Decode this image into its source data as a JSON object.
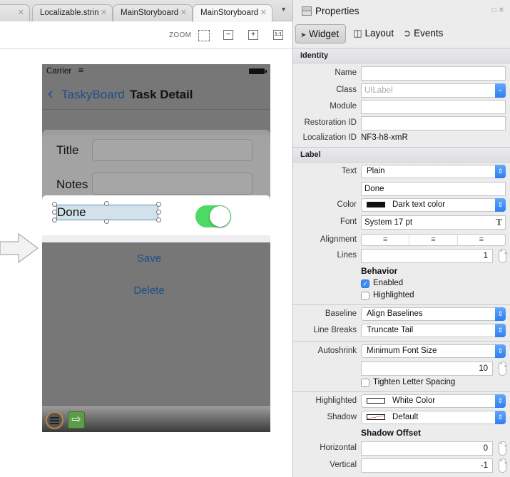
{
  "editor": {
    "tabs": [
      {
        "label": "",
        "active": false
      },
      {
        "label": "Localizable.strin",
        "active": false
      },
      {
        "label": "MainStoryboard",
        "active": false
      },
      {
        "label": "MainStoryboard",
        "active": true
      }
    ],
    "tab_close_glyph": "✕",
    "tab_dropdown_glyph": "▼",
    "zoom": {
      "label": "ZOOM",
      "buttons": [
        {
          "name": "zoom-fit",
          "glyph": ""
        },
        {
          "name": "zoom-out",
          "glyph": "−"
        },
        {
          "name": "zoom-in",
          "glyph": "+"
        },
        {
          "name": "zoom-actual",
          "glyph": "1:1"
        }
      ]
    }
  },
  "phone": {
    "carrier": "Carrier",
    "wifi_glyph": "≋",
    "back_label": "TaskyBoard",
    "back_glyph": "‹",
    "nav_title": "Task Detail",
    "title_label": "Title",
    "title_value": "",
    "notes_label": "Notes",
    "notes_value": "",
    "done_label": "Done",
    "done_switch_on": true,
    "save_label": "Save",
    "delete_label": "Delete",
    "exit_glyph": "⇨",
    "colors": {
      "link": "#1f4e8c",
      "switch_on": "#4cd964"
    }
  },
  "properties": {
    "title": "Properties",
    "window_buttons": "□ ✕",
    "tabs": [
      {
        "label": "Widget",
        "icon": "cursor-icon",
        "glyph": "➤",
        "active": true
      },
      {
        "label": "Layout",
        "icon": "layout-icon",
        "glyph": "◫",
        "active": false
      },
      {
        "label": "Events",
        "icon": "events-icon",
        "glyph": "➲",
        "active": false
      }
    ],
    "identity": {
      "header": "Identity",
      "name_label": "Name",
      "name_value": "",
      "class_label": "Class",
      "class_value": "UILabel",
      "module_label": "Module",
      "module_value": "",
      "restoration_label": "Restoration ID",
      "restoration_value": "",
      "localization_label": "Localization ID",
      "localization_value": "NF3-h8-xmR"
    },
    "label": {
      "header": "Label",
      "text_label": "Text",
      "text_type": "Plain",
      "text_value": "Done",
      "color_label": "Color",
      "color_value": "Dark text color",
      "font_label": "Font",
      "font_value": "System 17 pt",
      "alignment_label": "Alignment",
      "alignment_options": [
        "left",
        "center",
        "right"
      ],
      "lines_label": "Lines",
      "lines_value": "1",
      "behavior_header": "Behavior",
      "enabled_label": "Enabled",
      "enabled": true,
      "highlighted_label": "Highlighted",
      "highlighted": false,
      "baseline_label": "Baseline",
      "baseline_value": "Align Baselines",
      "linebreaks_label": "Line Breaks",
      "linebreaks_value": "Truncate Tail",
      "autoshrink_label": "Autoshrink",
      "autoshrink_value": "Minimum Font Size",
      "min_font_value": "10",
      "tighten_label": "Tighten Letter Spacing",
      "tighten": false,
      "highlighted_color_label": "Highlighted",
      "highlighted_color_value": "White Color",
      "shadow_label": "Shadow",
      "shadow_value": "Default",
      "shadow_offset_header": "Shadow Offset",
      "horizontal_label": "Horizontal",
      "horizontal_value": "0",
      "vertical_label": "Vertical",
      "vertical_value": "-1"
    },
    "glyphs": {
      "select_cap": "⇕",
      "dropdown_cap": "⌄",
      "stepper": "⌃⌄",
      "check": "✓",
      "font_picker": "T"
    }
  }
}
